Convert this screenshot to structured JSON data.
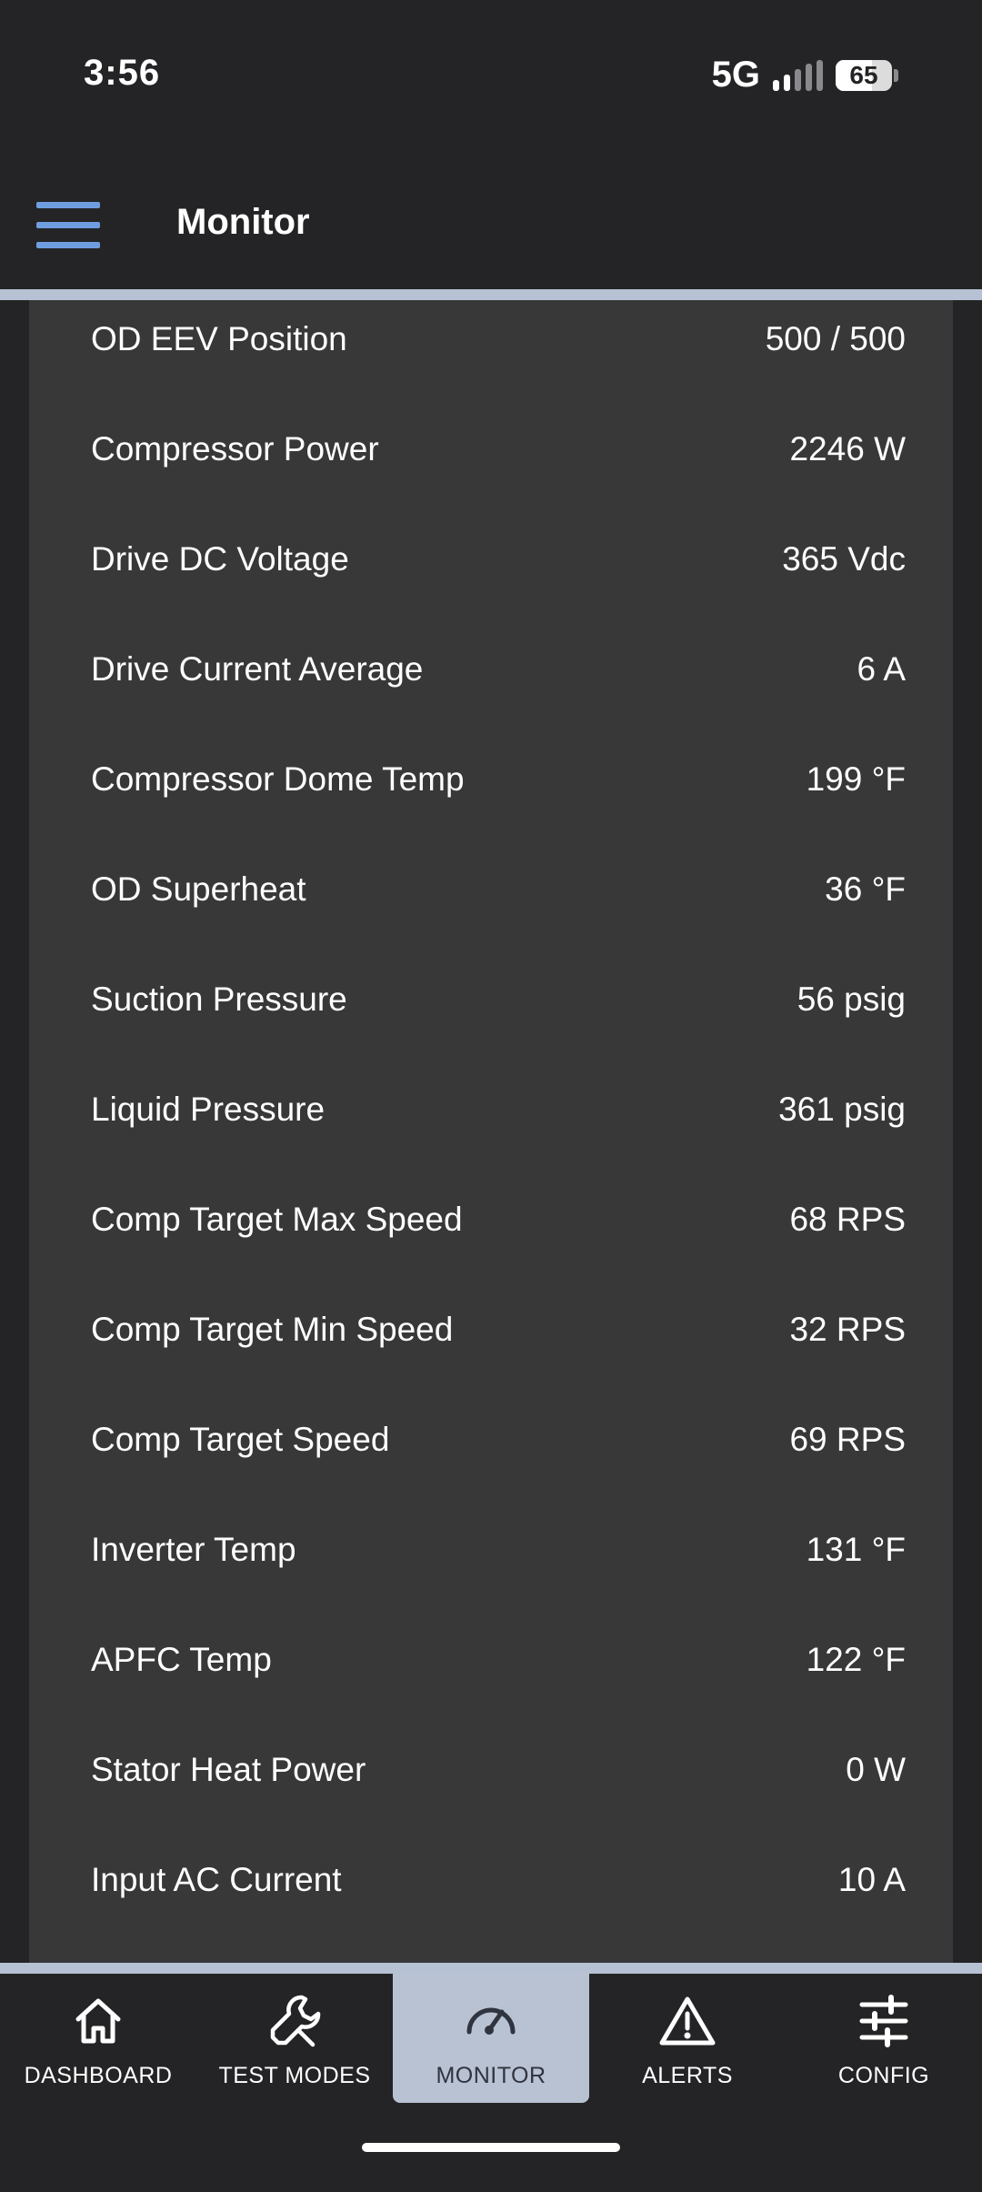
{
  "status_bar": {
    "time": "3:56",
    "network": "5G",
    "signal_bars_filled": 2,
    "signal_bars_total": 5,
    "battery_percent": "65"
  },
  "header": {
    "title": "Monitor",
    "menu_icon": "hamburger-menu-icon",
    "menu_color": "#6f9ee0"
  },
  "monitor_rows": [
    {
      "label": "OD EEV Position",
      "value": "500 / 500"
    },
    {
      "label": "Compressor Power",
      "value": "2246 W"
    },
    {
      "label": "Drive DC Voltage",
      "value": "365 Vdc"
    },
    {
      "label": "Drive Current Average",
      "value": "6 A"
    },
    {
      "label": "Compressor Dome Temp",
      "value": "199 °F"
    },
    {
      "label": "OD Superheat",
      "value": "36 °F"
    },
    {
      "label": "Suction Pressure",
      "value": "56 psig"
    },
    {
      "label": "Liquid Pressure",
      "value": "361 psig"
    },
    {
      "label": "Comp Target Max Speed",
      "value": "68 RPS"
    },
    {
      "label": "Comp Target Min Speed",
      "value": "32 RPS"
    },
    {
      "label": "Comp Target Speed",
      "value": "69 RPS"
    },
    {
      "label": "Inverter Temp",
      "value": "131 °F"
    },
    {
      "label": "APFC Temp",
      "value": "122 °F"
    },
    {
      "label": "Stator Heat Power",
      "value": "0 W"
    },
    {
      "label": "Input AC Current",
      "value": "10 A"
    }
  ],
  "bottom_nav": {
    "items": [
      {
        "label": "DASHBOARD",
        "icon": "home-icon",
        "active": false
      },
      {
        "label": "TEST MODES",
        "icon": "wrench-icon",
        "active": false
      },
      {
        "label": "MONITOR",
        "icon": "gauge-icon",
        "active": true
      },
      {
        "label": "ALERTS",
        "icon": "warning-triangle-icon",
        "active": false
      },
      {
        "label": "CONFIG",
        "icon": "sliders-icon",
        "active": false
      }
    ],
    "active_color": "#b9c2d2"
  }
}
